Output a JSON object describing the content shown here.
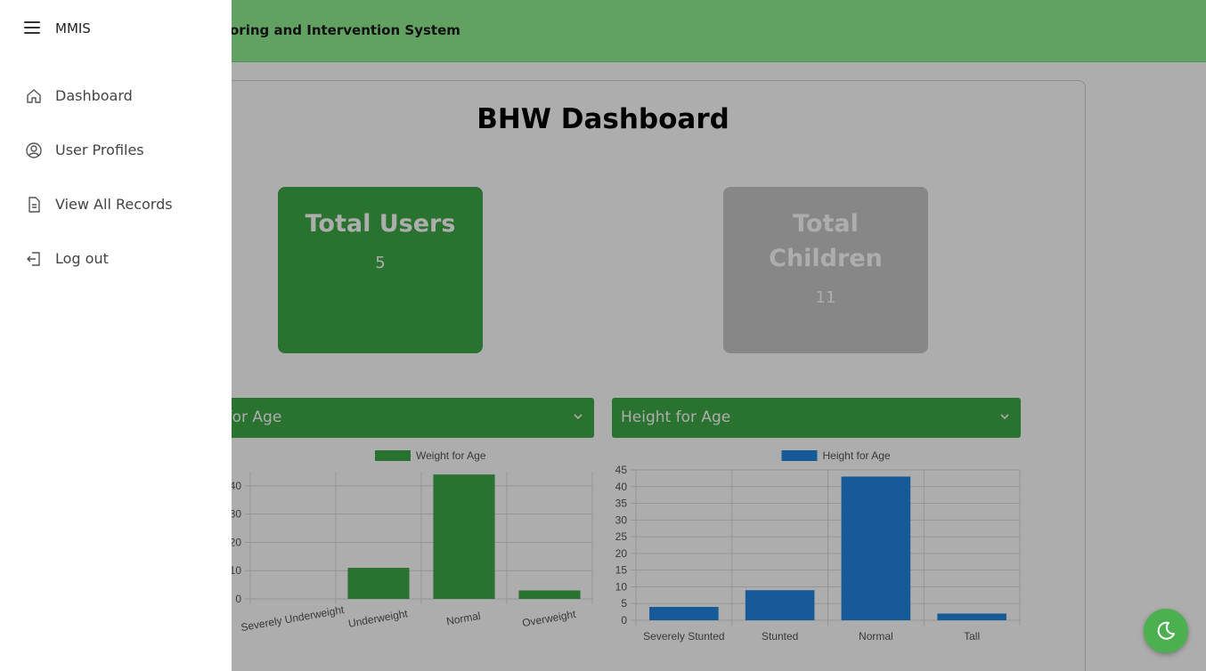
{
  "header": {
    "system_title": "Malnutrition Monitoring and Intervention System"
  },
  "main": {
    "page_title": "BHW Dashboard",
    "stats": [
      {
        "label": "Total Users",
        "value": "5",
        "color": "#3fa846"
      },
      {
        "label": "Total Children",
        "value": "11",
        "color": "#c8c8c8"
      }
    ],
    "selects": {
      "left_selected": "Weight for Age",
      "right_selected": "Height for Age"
    }
  },
  "sidebar": {
    "title": "MMIS",
    "items": [
      {
        "label": "Dashboard",
        "icon": "home-icon"
      },
      {
        "label": "User Profiles",
        "icon": "user-circle-icon"
      },
      {
        "label": "View All Records",
        "icon": "document-icon"
      },
      {
        "label": "Log out",
        "icon": "logout-icon"
      }
    ]
  },
  "theme_toggle": {
    "icon": "moon-icon"
  },
  "chart_data": [
    {
      "type": "bar",
      "legend": "Weight for Age",
      "categories": [
        "Severely Underweight",
        "Underweight",
        "Normal",
        "Overweight"
      ],
      "values": [
        0,
        11,
        44,
        3
      ],
      "ylim": [
        0,
        45
      ],
      "yticks": [
        0,
        10,
        20,
        30,
        40
      ],
      "color": "#3fa846",
      "grid": true,
      "legend_position": "top"
    },
    {
      "type": "bar",
      "legend": "Height for Age",
      "categories": [
        "Severely Stunted",
        "Stunted",
        "Normal",
        "Tall"
      ],
      "values": [
        4,
        9,
        43,
        2
      ],
      "ylim": [
        0,
        45
      ],
      "yticks": [
        0,
        5,
        10,
        15,
        20,
        25,
        30,
        35,
        40,
        45
      ],
      "color": "#2285e0",
      "grid": true,
      "legend_position": "top"
    }
  ]
}
